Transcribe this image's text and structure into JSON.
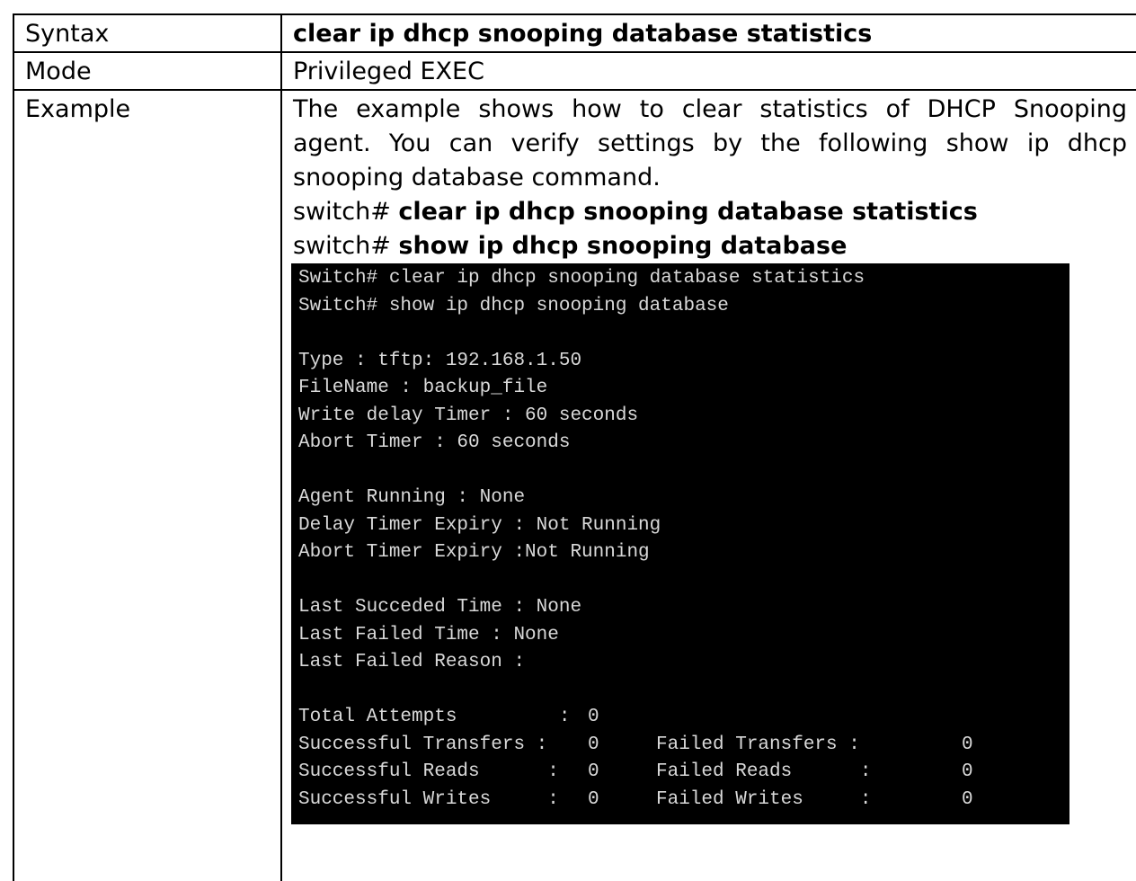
{
  "rows": {
    "syntax": {
      "label": "Syntax",
      "value": "clear ip dhcp snooping database statistics"
    },
    "mode": {
      "label": "Mode",
      "value": "Privileged EXEC"
    },
    "example": {
      "label": "Example",
      "description_lines": [
        "The example shows how to clear statistics of DHCP Snooping",
        "agent. You can verify settings by the following show ip dhcp",
        "snooping database command."
      ],
      "commands": [
        {
          "prompt": "switch#",
          "command": "clear ip dhcp snooping database statistics"
        },
        {
          "prompt": "switch#",
          "command": "show ip dhcp snooping database"
        }
      ]
    }
  },
  "terminal": {
    "lines": [
      "Switch# clear ip dhcp snooping database statistics",
      "Switch# show ip dhcp snooping database",
      "",
      "Type : tftp: 192.168.1.50",
      "FileName : backup_file",
      "Write delay Timer : 60 seconds",
      "Abort Timer : 60 seconds",
      "",
      "Agent Running : None",
      "Delay Timer Expiry : Not Running",
      "Abort Timer Expiry :Not Running",
      "",
      "Last Succeded Time : None",
      "Last Failed Time : None",
      "Last Failed Reason :",
      ""
    ],
    "stats": [
      {
        "label": "Total Attempts         :",
        "value": "0",
        "label2": "",
        "value2": ""
      },
      {
        "label": "Successful Transfers :",
        "value": "0",
        "label2": "Failed Transfers :",
        "value2": "0"
      },
      {
        "label": "Successful Reads      :",
        "value": "0",
        "label2": "Failed Reads      :",
        "value2": "0"
      },
      {
        "label": "Successful Writes     :",
        "value": "0",
        "label2": "Failed Writes     :",
        "value2": "0"
      }
    ]
  }
}
